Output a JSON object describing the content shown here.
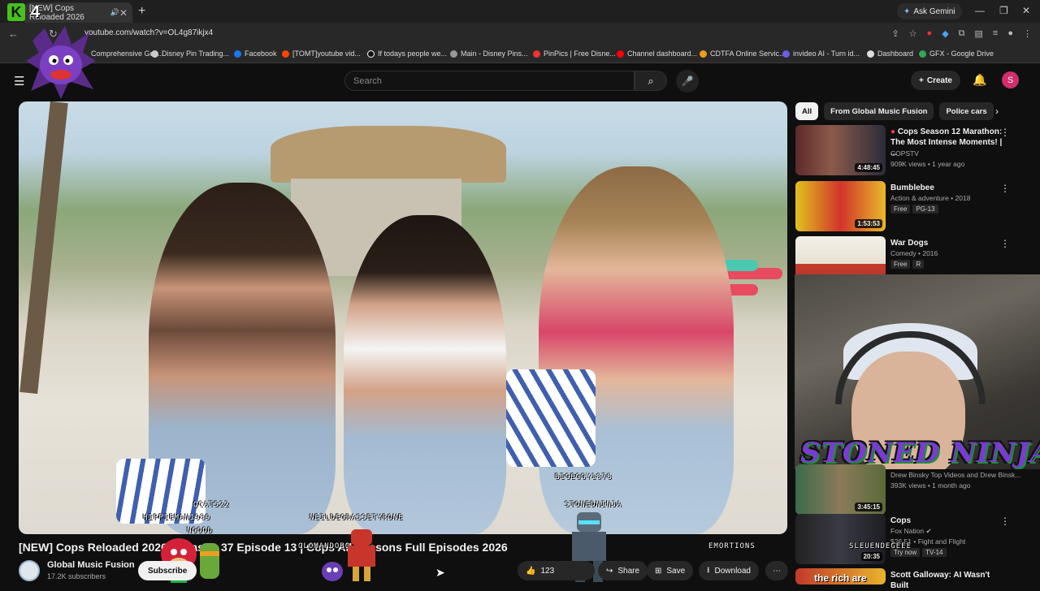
{
  "browser": {
    "tab_title": "[NEW] Cops Reloaded 2026",
    "url": "youtube.com/watch?v=OL4g87ikjx4",
    "ask_gemini": "Ask Gemini",
    "bookmarks": [
      "Comprehensive Gol...",
      "Disney Pin Trading...",
      "Facebook",
      "[TOMT]youtube vid...",
      "If todays people we...",
      "Main - Disney Pins...",
      "PinPics | Free Disne...",
      "Channel dashboard...",
      "CDTFA Online Servic...",
      "invideo AI - Turn id...",
      "Dashboard",
      "GFX - Google Drive"
    ]
  },
  "youtube": {
    "search_placeholder": "Search",
    "create_label": "Create",
    "avatar_letter": "S",
    "video_title": "[NEW] Cops Reloaded 2026 - Season 37 Episode 13 | Cops All Seasons Full Episodes 2026",
    "channel_name": "Global Music Fusion",
    "channel_subs": "17.2K subscribers",
    "subscribe_label": "Subscribe",
    "like_count": "123",
    "share_label": "Share",
    "save_label": "Save",
    "download_label": "Download",
    "chips": [
      "All",
      "From Global Music Fusion",
      "Police cars"
    ],
    "recommendations": [
      {
        "title": "Cops Season 12 Marathon: The Most Intense Moments! | ...",
        "meta1": "COPSTV",
        "meta2": "909K views • 1 year ago",
        "duration": "4:48:45"
      },
      {
        "title": "Bumblebee",
        "meta1": "Action & adventure • 2018",
        "badges": [
          "Free",
          "PG-13"
        ],
        "duration": "1:53:53"
      },
      {
        "title": "War Dogs",
        "meta1": "Comedy • 2016",
        "badges": [
          "Free",
          "R"
        ]
      },
      {
        "title": "",
        "meta1": "Drew Binsky Top Videos and Drew Binsk...",
        "meta2": "393K views • 1 month ago",
        "duration": "3:45:15"
      },
      {
        "title": "Cops",
        "meta1": "Fox Nation",
        "meta2": "$26.51 • Fight and Flight",
        "badges": [
          "Try now",
          "TV-14"
        ],
        "duration": "20:35"
      },
      {
        "title": "Scott Galloway: AI Wasn't Built",
        "meta1": ""
      }
    ]
  },
  "stream_overlay": {
    "brand": "STONED NINJA",
    "logo_k": "K",
    "logo_4": "4",
    "chatters": [
      "HIPPIEMAN1989",
      "QCAT522",
      "NGOOD",
      "NEILDEGRASSETYRONE",
      "BIGEGGY1878",
      "STONEDNINJA",
      "OLOMANDOBO",
      "EMORTIONS",
      "SLEUENDEGEEE"
    ],
    "caption_fragment": "the rich are"
  },
  "colors": {
    "accent_red": "#ff0000",
    "avatar_pink": "#d12e6d",
    "overlay_purple": "#7a3bd1",
    "overlay_green": "#1b8f3a"
  }
}
